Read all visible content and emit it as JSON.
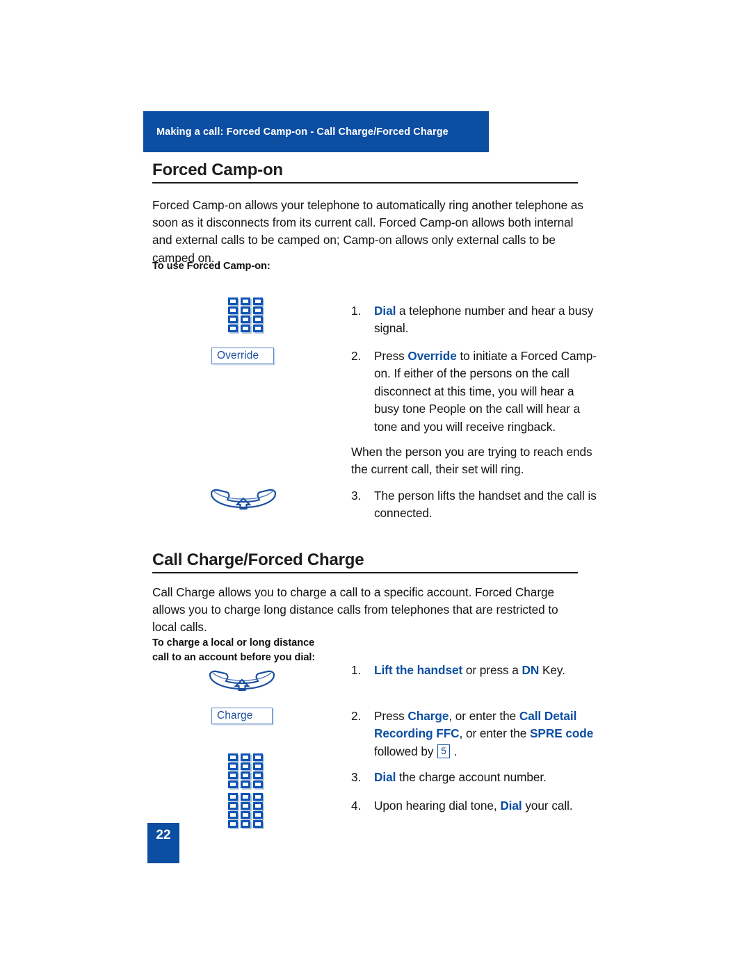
{
  "banner": {
    "title": "Making a call: Forced Camp-on - Call Charge/Forced Charge"
  },
  "section1": {
    "heading": "Forced Camp-on",
    "paragraph": "Forced Camp-on allows your telephone to automatically ring another telephone as soon as it disconnects from its current call. Forced Camp-on allows both internal and external calls to be camped on; Camp-on allows only external calls to be camped on.",
    "lead_in": "To use Forced Camp-on:",
    "steps": [
      {
        "num": "1.",
        "text_before": "",
        "bold": "Dial",
        "text_after": " a telephone number and hear a busy signal."
      },
      {
        "num": "2.",
        "text_before": "Press ",
        "bold": "Override",
        "text_after": " to initiate a Forced Camp-on. If either of the persons on the call disconnect at this time, you will hear a busy tone People on the call will hear a tone and you will receive ringback."
      },
      {
        "num": "3.",
        "text_before": "The person lifts the handset and the call is connected.",
        "bold": "",
        "text_after": ""
      }
    ],
    "note": "When the person you are trying to reach ends the current call, their set will ring.",
    "softkey_label": "Override"
  },
  "section2": {
    "heading": "Call Charge/Forced Charge",
    "paragraph": "Call Charge allows you to charge a call to a specific account. Forced Charge allows you to charge long distance calls from telephones that are restricted to local calls.",
    "lead_in_line1": "To charge a local or long distance",
    "lead_in_line2": "call to an account before you dial:",
    "softkey_label": "Charge",
    "steps": [
      {
        "num": "1.",
        "segments": [
          {
            "t": "Lift the handset",
            "b": true
          },
          {
            "t": " or press a ",
            "b": false
          },
          {
            "t": "DN",
            "b": true
          },
          {
            "t": " Key.",
            "b": false
          }
        ]
      },
      {
        "num": "2.",
        "segments": [
          {
            "t": "Press ",
            "b": false
          },
          {
            "t": "Charge",
            "b": true
          },
          {
            "t": ", or enter the ",
            "b": false
          },
          {
            "t": "Call Detail Recording FFC",
            "b": true
          },
          {
            "t": ", or enter the ",
            "b": false
          },
          {
            "t": "SPRE code",
            "b": true
          },
          {
            "t": " followed by ",
            "b": false
          },
          {
            "t": "KEY5",
            "b": false
          },
          {
            "t": " .",
            "b": false
          }
        ]
      },
      {
        "num": "3.",
        "segments": [
          {
            "t": "Dial",
            "b": true
          },
          {
            "t": " the charge account number.",
            "b": false
          }
        ]
      },
      {
        "num": "4.",
        "segments": [
          {
            "t": "Upon hearing dial tone, ",
            "b": false
          },
          {
            "t": "Dial",
            "b": true
          },
          {
            "t": " your call.",
            "b": false
          }
        ]
      }
    ],
    "inline_key": "5"
  },
  "page_number": "22",
  "icons": {
    "keypad": "dialpad-icon",
    "handset": "lift-handset-icon"
  },
  "colors": {
    "brand_blue": "#0B4EA2",
    "accent_blue": "#1A4FA0",
    "icon_blue": "#1055B5",
    "softkey_border": "#5B86C4",
    "text": "#141414"
  }
}
